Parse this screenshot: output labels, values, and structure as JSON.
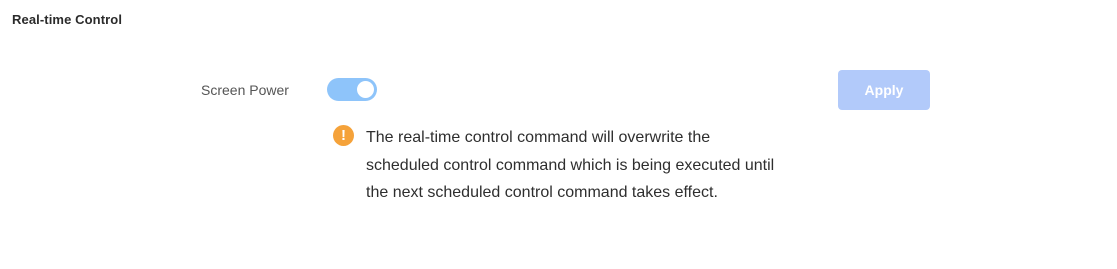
{
  "section": {
    "title": "Real-time Control"
  },
  "screen_power": {
    "label": "Screen Power",
    "enabled": true
  },
  "actions": {
    "apply_label": "Apply"
  },
  "notice": {
    "icon": "warning-icon",
    "icon_glyph": "!",
    "text": "The real-time control command will overwrite the scheduled control command which is being executed until the next scheduled control command takes effect."
  },
  "colors": {
    "toggle_on": "#8ec4fa",
    "apply_disabled": "#b2cafa",
    "warning": "#f5a23a"
  }
}
